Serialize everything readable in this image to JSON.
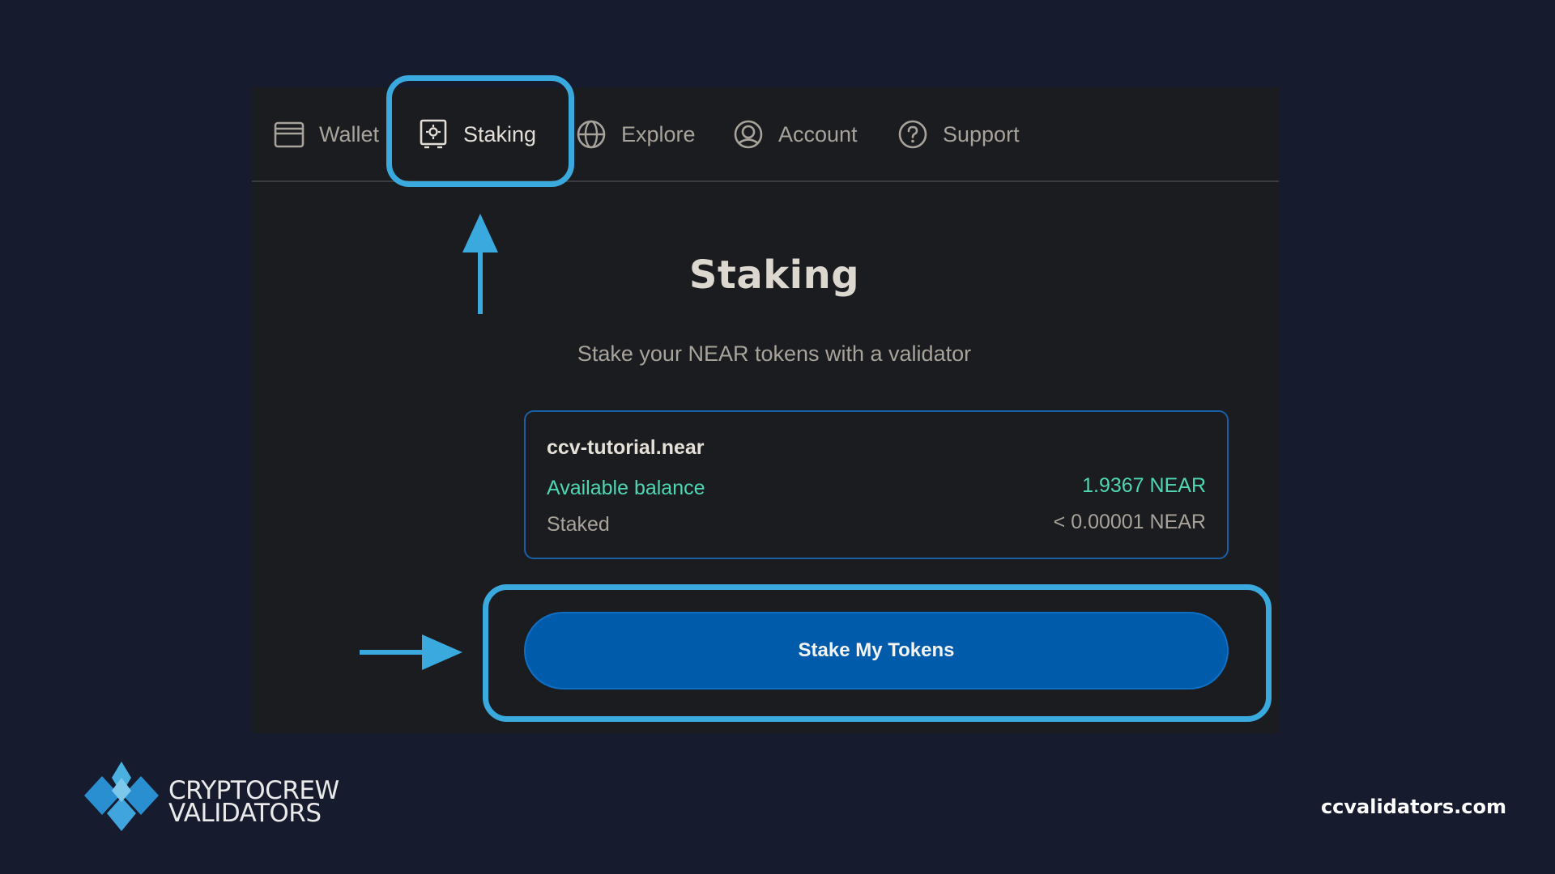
{
  "nav": {
    "items": [
      {
        "label": "Wallet",
        "icon": "wallet-icon"
      },
      {
        "label": "Staking",
        "icon": "staking-safe-icon",
        "active": true
      },
      {
        "label": "Explore",
        "icon": "globe-icon"
      },
      {
        "label": "Account",
        "icon": "account-icon"
      },
      {
        "label": "Support",
        "icon": "help-circle-icon"
      }
    ]
  },
  "main": {
    "title": "Staking",
    "subtitle": "Stake your NEAR tokens with a validator",
    "account_card": {
      "account_name": "ccv-tutorial.near",
      "available_label": "Available balance",
      "available_value": "1.9367 NEAR",
      "staked_label": "Staked",
      "staked_value": "< 0.00001 NEAR"
    },
    "stake_button_label": "Stake My Tokens"
  },
  "branding": {
    "name_line1": "CRYPTOCREW",
    "name_line2": "VALIDATORS",
    "website": "ccvalidators.com"
  },
  "colors": {
    "page_background": "#171b2e",
    "panel_background": "#1b1c20",
    "highlight": "#3aa9de",
    "accent_green": "#4fd6b3",
    "button_blue": "#005bab"
  }
}
